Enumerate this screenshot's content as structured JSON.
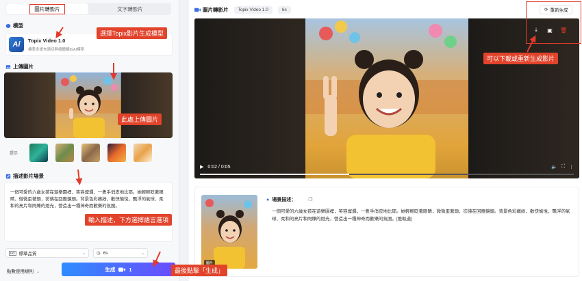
{
  "left": {
    "tabs": [
      {
        "label": "圖片轉影片",
        "active": true
      },
      {
        "label": "文字轉影片",
        "active": false
      }
    ],
    "model_section": "模型",
    "model": {
      "logo": "Ai",
      "name": "Topix Video 1.0",
      "desc": "標準多語言適切與總體類似AI模型"
    },
    "upload_section": "上傳圖片",
    "thumbs_label": "提示",
    "prompt_section": "描述影片場景",
    "prompt_text": "一個可愛的六歲女孩在遊樂園裡，笑容燦爛，一隻手俏皮地比耶。她輕輕眨著眼睛，微微歪著頭，彷彿在回應鏡頭。背景色彩繽紛，歡快愉悅，飄浮的氣球、柔和的亮片和閃爍的燈光，營造出一種神奇而歡樂的氛圍。",
    "quality": {
      "badge": "HD",
      "label": "標準品質"
    },
    "duration": "6s",
    "rules": "點數使用規則",
    "generate": {
      "label": "生成",
      "count": "1"
    }
  },
  "right": {
    "title": "圖片轉影片",
    "chips": [
      "Topix Video 1.0",
      "6s"
    ],
    "regen_label": "重新生成",
    "video": {
      "time": "0:02 / 0:05",
      "progress": 0.4
    },
    "detail_label": "場景描述：",
    "detail_badge": "圖片",
    "detail_text": "一個可愛的六歲女孩在遊樂園裡，笑容燦爛，一隻手俏皮地比耶。她輕輕眨著眼睛，微微歪著頭，彷彿在回應鏡頭。背景色彩繽紛，歡快愉悅，飄浮的氣球、柔和的亮片和閃爍的燈光，營造出一種神奇而歡樂的氛圍。",
    "detail_tag": "[推軌道]"
  },
  "annotations": {
    "model": "選擇Topix影片生成模型",
    "upload": "此處上傳圖片",
    "prompt": "輸入描述，下方選擇語言選項",
    "generate": "最後點擊「生成」",
    "download": "可以下載或重新生成影片"
  },
  "colors": {
    "accent": "#e23a2a",
    "gradient_start": "#2f8cff",
    "gradient_end": "#6b4cff"
  }
}
